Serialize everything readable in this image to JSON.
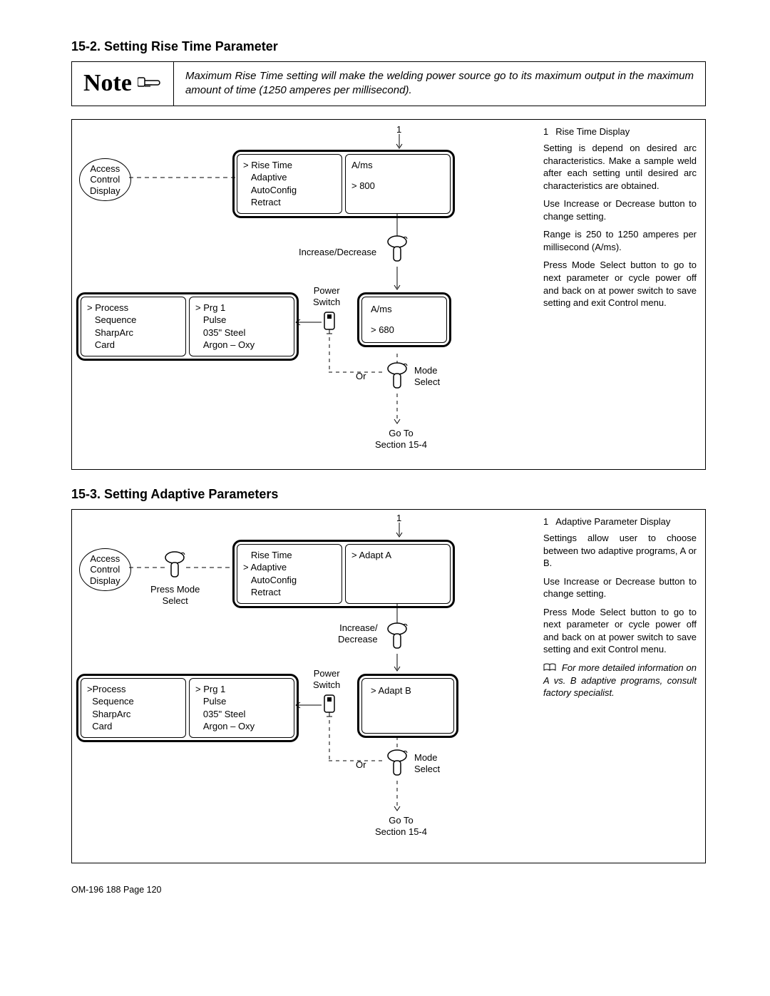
{
  "section1": {
    "title": "15-2. Setting Rise Time Parameter",
    "note_label": "Note",
    "note_text": "Maximum Rise Time setting will make the welding power source go to its maximum output in the maximum amount of time (1250 amperes per millisecond).",
    "callout_num": "1",
    "oval": "Access\nControl\nDisplay",
    "panel1_left": "> Rise Time\n   Adaptive\n   AutoConfig\n   Retract",
    "panel1_right_top": "A/ms",
    "panel1_right_bot": "> 800",
    "incdec": "Increase/Decrease",
    "panel2_left": "> Process\n   Sequence\n   SharpArc\n   Card",
    "panel2_mid": "> Prg 1\n   Pulse\n   035\" Steel\n   Argon – Oxy",
    "power_switch": "Power\nSwitch",
    "panel3_top": "A/ms",
    "panel3_bot": "> 680",
    "or": "Or",
    "mode_select": "Mode\nSelect",
    "goto": "Go To\nSection 15-4",
    "right": {
      "num": "1",
      "head": "Rise Time Display",
      "p1": "Setting is depend on desired arc characteristics. Make a sample weld after each setting until desired arc characteristics are obtained.",
      "p2": "Use Increase or Decrease button to change setting.",
      "p3": "Range is 250 to 1250 amperes per millisecond (A/ms).",
      "p4": "Press Mode Select button to go to next parameter or cycle power off and back on at power switch to save setting and exit Control menu."
    }
  },
  "section2": {
    "title": "15-3. Setting Adaptive Parameters",
    "callout_num": "1",
    "oval": "Access\nControl\nDisplay",
    "press_mode": "Press Mode\nSelect",
    "panel1_left": "   Rise Time\n> Adaptive\n   AutoConfig\n   Retract",
    "panel1_right": "> Adapt A",
    "incdec": "Increase/\nDecrease",
    "panel2_left": ">Process\n  Sequence\n  SharpArc\n  Card",
    "panel2_mid": "> Prg 1\n   Pulse\n   035\" Steel\n   Argon – Oxy",
    "power_switch": "Power\nSwitch",
    "panel3": "> Adapt B",
    "or": "Or",
    "mode_select": "Mode\nSelect",
    "goto": "Go To\nSection 15-4",
    "right": {
      "num": "1",
      "head": "Adaptive Parameter Display",
      "p1": "Settings allow user to choose between two adaptive programs, A or B.",
      "p2": "Use Increase or Decrease button to change setting.",
      "p3": "Press Mode Select button to go to next parameter or cycle power off and back on at power switch to save setting and exit Control menu.",
      "foot": "For more detailed information on A vs. B adaptive programs, consult factory specialist."
    }
  },
  "footer": "OM-196 188 Page 120"
}
